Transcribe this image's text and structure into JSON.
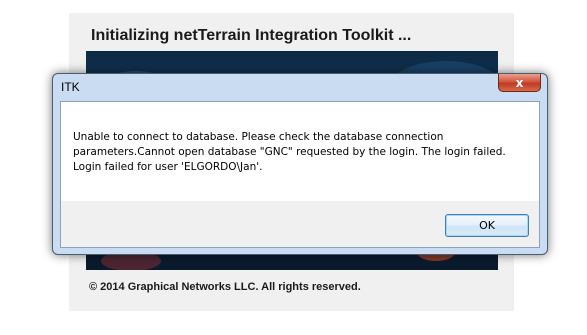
{
  "splash": {
    "title": "Initializing netTerrain Integration Toolkit ...",
    "copyright": "© 2014 Graphical Networks LLC. All rights reserved."
  },
  "dialog": {
    "title": "ITK",
    "close_label": "x",
    "message_lines": [
      "Unable to connect to database. Please check the database connection",
      "parameters.Cannot open database \"GNC\" requested by the login. The login failed.",
      "Login failed for user 'ELGORDO\\Jan'."
    ],
    "ok_label": "OK"
  },
  "colors": {
    "banner": "#0d2a44",
    "close_button": "#c03a22",
    "ok_border": "#3c7fb1"
  }
}
